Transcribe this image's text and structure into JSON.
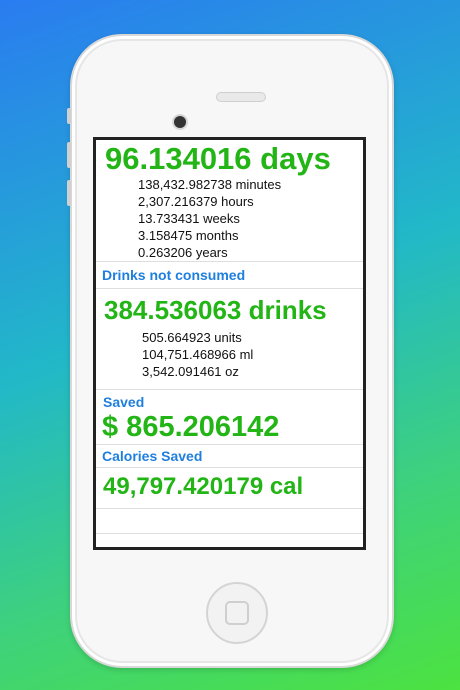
{
  "time_section": {
    "headline": "96.134016 days",
    "details": [
      "138,432.982738 minutes",
      "2,307.216379 hours",
      "13.733431 weeks",
      "3.158475 months",
      "0.263206 years"
    ]
  },
  "drinks_section": {
    "header": "Drinks not consumed",
    "headline": "384.536063 drinks",
    "details": [
      "505.664923 units",
      "104,751.468966 ml",
      "3,542.091461 oz"
    ]
  },
  "saved_section": {
    "header": "Saved",
    "headline": "$ 865.206142"
  },
  "calories_section": {
    "header": "Calories Saved",
    "headline": "49,797.420179 cal"
  },
  "colors": {
    "value_green": "#22b515",
    "header_blue": "#1f7fde"
  }
}
